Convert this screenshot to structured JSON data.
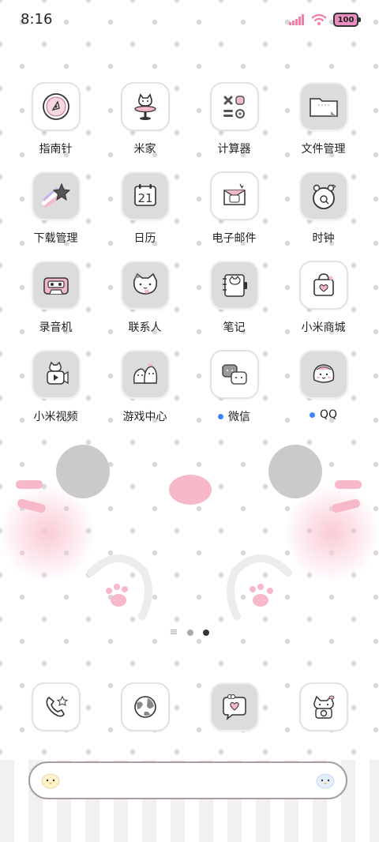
{
  "status_bar": {
    "time": "8:16",
    "battery": "100"
  },
  "apps": [
    {
      "label": "指南针",
      "icon": "compass-icon"
    },
    {
      "label": "米家",
      "icon": "cat-chair-icon"
    },
    {
      "label": "计算器",
      "icon": "calculator-icon"
    },
    {
      "label": "文件管理",
      "icon": "folder-icon"
    },
    {
      "label": "下载管理",
      "icon": "shooting-star-icon"
    },
    {
      "label": "日历",
      "icon": "calendar-icon",
      "text": "21"
    },
    {
      "label": "电子邮件",
      "icon": "envelope-icon"
    },
    {
      "label": "时钟",
      "icon": "clock-icon"
    },
    {
      "label": "录音机",
      "icon": "cassette-icon"
    },
    {
      "label": "联系人",
      "icon": "cat-face-icon"
    },
    {
      "label": "笔记",
      "icon": "notebook-icon"
    },
    {
      "label": "小米商城",
      "icon": "shopping-bag-icon"
    },
    {
      "label": "小米视频",
      "icon": "video-camera-icon"
    },
    {
      "label": "游戏中心",
      "icon": "friends-icon"
    },
    {
      "label": "微信",
      "icon": "chat-bubbles-icon",
      "has_notification": true
    },
    {
      "label": "QQ",
      "icon": "penguin-icon",
      "has_notification": true
    }
  ],
  "dock": [
    {
      "icon": "phone-icon"
    },
    {
      "icon": "globe-icon"
    },
    {
      "icon": "message-heart-icon"
    },
    {
      "icon": "camera-icon"
    }
  ],
  "search": {
    "placeholder": ""
  },
  "colors": {
    "accent_pink": "#f6c1cf",
    "notification_blue": "#3a86ff",
    "tile_grey": "#dcdcdc"
  }
}
